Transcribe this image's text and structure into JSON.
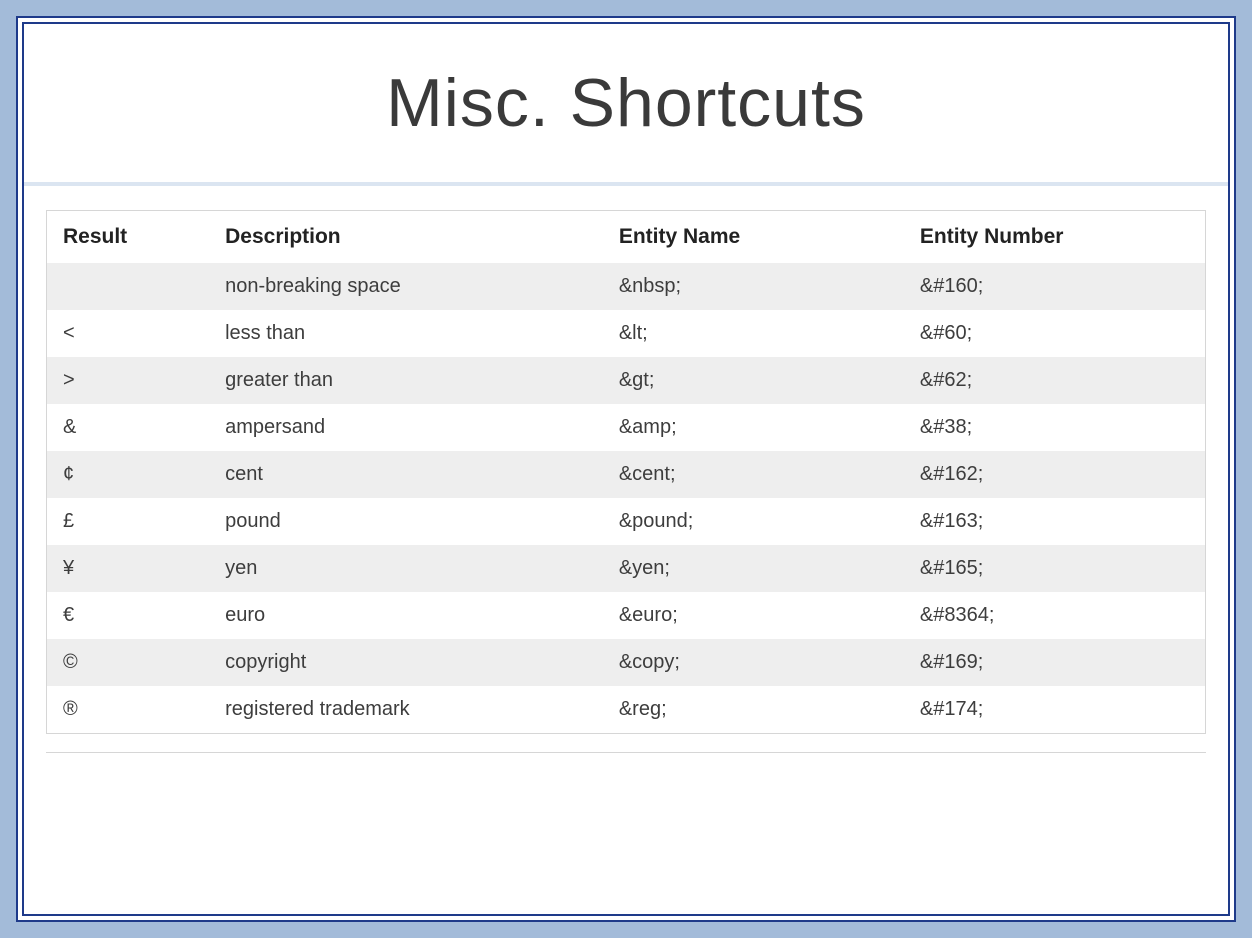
{
  "title": "Misc. Shortcuts",
  "headers": {
    "result": "Result",
    "description": "Description",
    "entity_name": "Entity Name",
    "entity_number": "Entity Number"
  },
  "rows": [
    {
      "result": " ",
      "description": "non-breaking space",
      "entity_name": "&nbsp;",
      "entity_number": "&#160;"
    },
    {
      "result": "<",
      "description": "less than",
      "entity_name": "&lt;",
      "entity_number": "&#60;"
    },
    {
      "result": ">",
      "description": "greater than",
      "entity_name": "&gt;",
      "entity_number": "&#62;"
    },
    {
      "result": "&",
      "description": "ampersand",
      "entity_name": "&amp;",
      "entity_number": "&#38;"
    },
    {
      "result": "¢",
      "description": "cent",
      "entity_name": "&cent;",
      "entity_number": "&#162;"
    },
    {
      "result": "£",
      "description": "pound",
      "entity_name": "&pound;",
      "entity_number": "&#163;"
    },
    {
      "result": "¥",
      "description": "yen",
      "entity_name": "&yen;",
      "entity_number": "&#165;"
    },
    {
      "result": "€",
      "description": "euro",
      "entity_name": "&euro;",
      "entity_number": "&#8364;"
    },
    {
      "result": "©",
      "description": "copyright",
      "entity_name": "&copy;",
      "entity_number": "&#169;"
    },
    {
      "result": "®",
      "description": "registered trademark",
      "entity_name": "&reg;",
      "entity_number": "&#174;"
    }
  ]
}
